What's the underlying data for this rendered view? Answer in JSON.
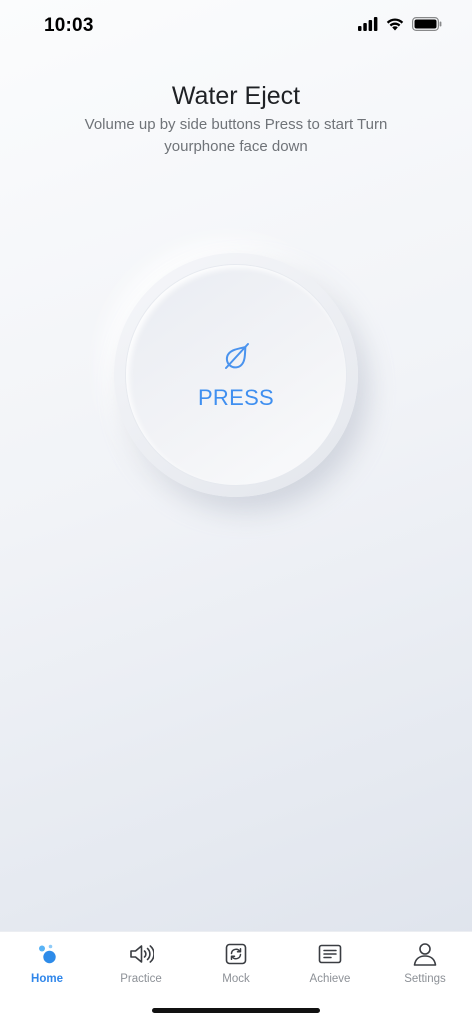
{
  "status_bar": {
    "time": "10:03",
    "icons": [
      "signal-icon",
      "wifi-icon",
      "battery-icon"
    ]
  },
  "header": {
    "title": "Water Eject",
    "subtitle": "Volume up by side buttons Press to start Turn yourphone face down"
  },
  "press_button": {
    "label": "PRESS",
    "icon": "water-drop-off-icon",
    "accent_color": "#3f8ff0"
  },
  "tab_bar": {
    "active_color": "#2f86ea",
    "inactive_color": "#8d9197",
    "items": [
      {
        "label": "Home",
        "icon": "bubbles-icon",
        "active": true
      },
      {
        "label": "Practice",
        "icon": "speaker-icon",
        "active": false
      },
      {
        "label": "Mock",
        "icon": "refresh-square-icon",
        "active": false
      },
      {
        "label": "Achieve",
        "icon": "document-icon",
        "active": false
      },
      {
        "label": "Settings",
        "icon": "person-icon",
        "active": false
      }
    ]
  }
}
